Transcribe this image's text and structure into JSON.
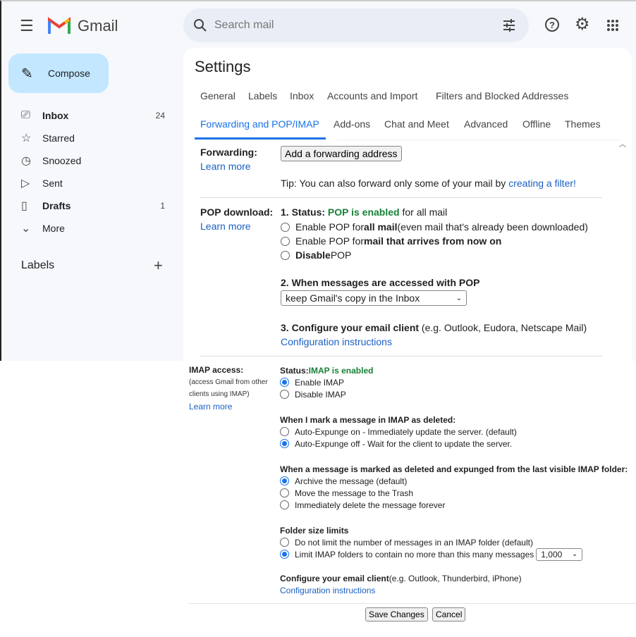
{
  "header": {
    "app": "Gmail",
    "search_placeholder": "Search mail",
    "icons": [
      "menu-icon",
      "gmail-logo",
      "search-icon",
      "filter-options-icon",
      "help-icon",
      "gear-icon",
      "apps-grid-icon"
    ]
  },
  "sidebar": {
    "compose": "Compose",
    "items": [
      {
        "label": "Inbox",
        "count": "24",
        "bold": true,
        "icon": "inbox-icon"
      },
      {
        "label": "Starred",
        "count": "",
        "icon": "star-icon"
      },
      {
        "label": "Snoozed",
        "count": "",
        "icon": "clock-icon"
      },
      {
        "label": "Sent",
        "count": "",
        "icon": "send-icon"
      },
      {
        "label": "Drafts",
        "count": "1",
        "bold": true,
        "icon": "draft-icon"
      },
      {
        "label": "More",
        "count": "",
        "icon": "chevron-down-icon"
      }
    ],
    "labels_heading": "Labels"
  },
  "settings": {
    "title": "Settings",
    "tabs_row1": [
      "General",
      "Labels",
      "Inbox",
      "Accounts and Import",
      "Filters and Blocked Addresses"
    ],
    "tabs_row2": [
      "Forwarding and POP/IMAP",
      "Add-ons",
      "Chat and Meet",
      "Advanced",
      "Offline",
      "Themes"
    ],
    "active_tab": "Forwarding and POP/IMAP",
    "accent": "#1a73e8"
  },
  "forwarding": {
    "label": "Forwarding:",
    "learn_more": "Learn more",
    "button": "Add a forwarding address",
    "tip": "Tip: You can also forward only some of your mail by ",
    "tip_link": "creating a filter!"
  },
  "pop": {
    "label": "POP download:",
    "learn_more": "Learn more",
    "status_prefix": "1. Status: ",
    "status": "POP is enabled",
    "status_suffix": " for all mail",
    "options": [
      {
        "pre": "Enable POP for ",
        "bold": "all mail",
        "post": " (even mail that's already been downloaded)",
        "checked": false
      },
      {
        "pre": "Enable POP for ",
        "bold": "mail that arrives from now on",
        "post": "",
        "checked": false
      },
      {
        "pre": "",
        "bold": "Disable",
        "post": " POP",
        "checked": false
      }
    ],
    "q2": "2. When messages are accessed with POP",
    "q2_select": "keep Gmail's copy in the Inbox",
    "q3": "3. Configure your email client",
    "q3_hint": " (e.g. Outlook, Eudora, Netscape Mail)",
    "config_link": "Configuration instructions"
  },
  "imap": {
    "label": "IMAP access:",
    "sub1": "(access Gmail from other",
    "sub2": "clients using IMAP)",
    "learn_more": "Learn more",
    "status_prefix": "Status: ",
    "status": "IMAP is enabled",
    "access": [
      {
        "label": "Enable IMAP",
        "checked": true
      },
      {
        "label": "Disable IMAP",
        "checked": false
      }
    ],
    "deleted_heading": "When I mark a message in IMAP as deleted:",
    "deleted": [
      {
        "label": "Auto-Expunge on - Immediately update the server. (default)",
        "checked": false
      },
      {
        "label": "Auto-Expunge off - Wait for the client to update the server.",
        "checked": true
      }
    ],
    "expunged_heading": "When a message is marked as deleted and expunged from the last visible IMAP folder:",
    "expunged": [
      {
        "label": "Archive the message (default)",
        "checked": true
      },
      {
        "label": "Move the message to the Trash",
        "checked": false
      },
      {
        "label": "Immediately delete the message forever",
        "checked": false
      }
    ],
    "folder_heading": "Folder size limits",
    "folder": [
      {
        "label": "Do not limit the number of messages in an IMAP folder (default)",
        "checked": false
      },
      {
        "label": "Limit IMAP folders to contain no more than this many messages",
        "checked": true
      }
    ],
    "folder_select": "1,000",
    "config_heading": "Configure your email client",
    "config_hint": " (e.g. Outlook, Thunderbird, iPhone)",
    "config_link": "Configuration instructions"
  },
  "footer": {
    "save": "Save Changes",
    "cancel": "Cancel"
  }
}
